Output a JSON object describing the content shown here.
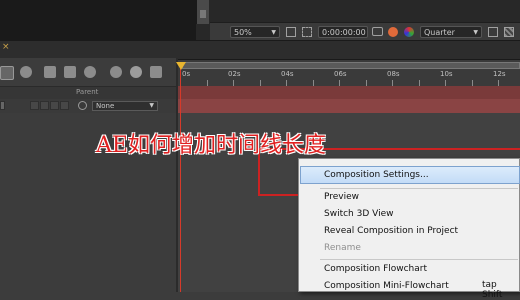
{
  "viewer": {
    "zoom": "50%",
    "timecode": "0:00:00:00",
    "resolution": "Quarter"
  },
  "timeline": {
    "header": {
      "parent_label": "Parent"
    },
    "layer": {
      "parent_value": "None"
    },
    "ruler_ticks": [
      "0s",
      "02s",
      "04s",
      "06s",
      "08s",
      "10s",
      "12s"
    ]
  },
  "annotation": {
    "text": "AE如何增加时间线长度"
  },
  "context_menu": {
    "items": [
      {
        "label": "Composition Settings...",
        "highlighted": true,
        "enabled": true
      },
      {
        "label": "Preview",
        "enabled": true
      },
      {
        "label": "Switch 3D View",
        "enabled": true
      },
      {
        "label": "Reveal Composition in Project",
        "enabled": true
      },
      {
        "label": "Rename",
        "enabled": false
      },
      {
        "label": "Composition Flowchart",
        "enabled": true
      },
      {
        "label": "Composition Mini-Flowchart",
        "enabled": true
      }
    ],
    "mini_flowchart_shortcut": "tap Shift"
  },
  "colors": {
    "accent_highlight": "#c3dcf7",
    "annotation_red": "#e02020",
    "playhead": "#d63a2a",
    "layer_bar": "#8a4444"
  }
}
